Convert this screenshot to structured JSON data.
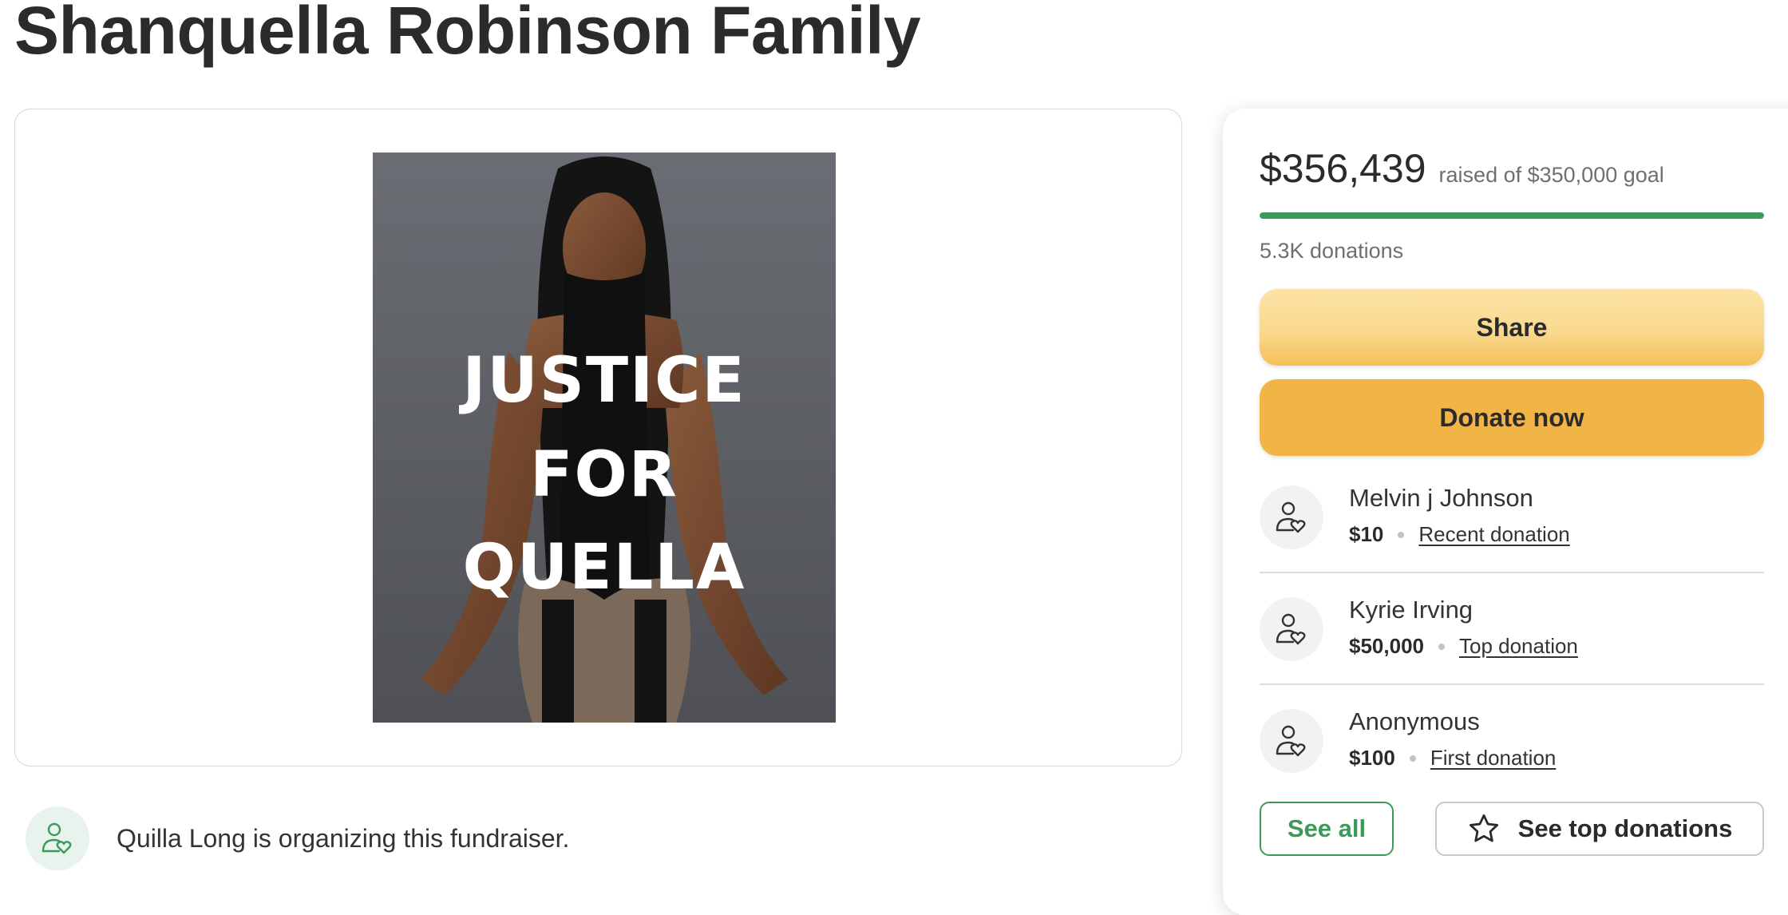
{
  "campaign": {
    "title": "Shanquella Robinson Family",
    "image": {
      "text_lines": [
        "JUSTICE",
        "FOR",
        "QUELLA"
      ],
      "icon": "campaign-photo"
    }
  },
  "organizer": {
    "text": "Quilla Long is organizing this fundraiser.",
    "icon": "user-heart-icon"
  },
  "fundraising": {
    "amount_raised": "$356,439",
    "goal_text": "raised of $350,000 goal",
    "progress_fraction": 1.0,
    "donation_count": "5.3K donations",
    "progress_color": "#3b9a5a"
  },
  "actions": {
    "share_label": "Share",
    "donate_label": "Donate now",
    "see_all_label": "See all",
    "see_top_label": "See top donations"
  },
  "donors": [
    {
      "name": "Melvin j Johnson",
      "amount": "$10",
      "tag": "Recent donation"
    },
    {
      "name": "Kyrie Irving",
      "amount": "$50,000",
      "tag": "Top donation"
    },
    {
      "name": "Anonymous",
      "amount": "$100",
      "tag": "First donation"
    }
  ],
  "colors": {
    "accent_green": "#3b9a5a",
    "donate_yellow": "#f1b547",
    "share_yellow": "#f9d98f"
  }
}
